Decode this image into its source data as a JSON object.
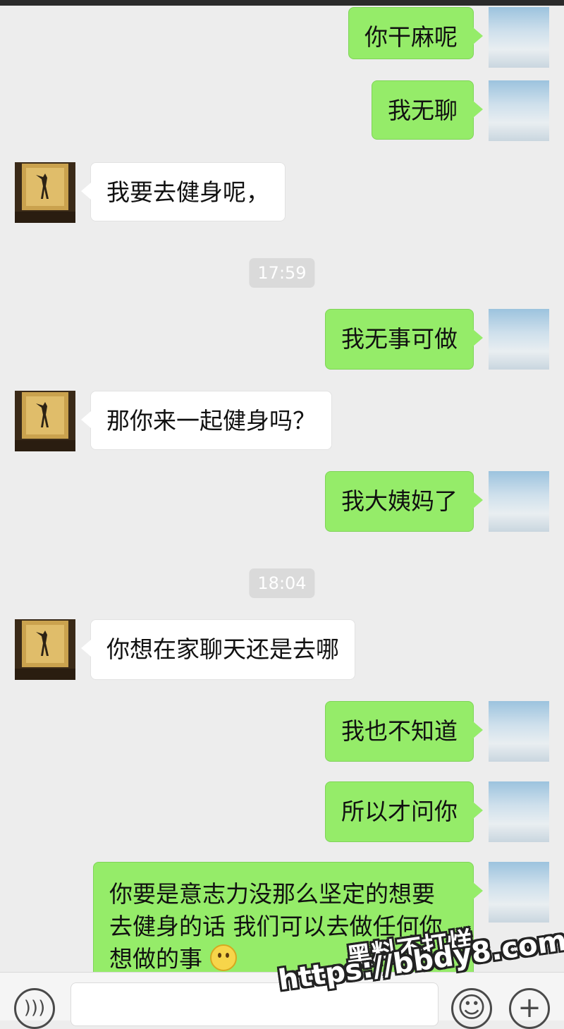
{
  "chat": {
    "messages": [
      {
        "side": "me",
        "text": "你干麻呢"
      },
      {
        "side": "me",
        "text": "我无聊"
      },
      {
        "side": "other",
        "text": "我要去健身呢，"
      },
      {
        "side": "time",
        "text": "17:59"
      },
      {
        "side": "me",
        "text": "我无事可做"
      },
      {
        "side": "other",
        "text": "那你来一起健身吗？"
      },
      {
        "side": "me",
        "text": "我大姨妈了"
      },
      {
        "side": "time",
        "text": "18:04"
      },
      {
        "side": "other",
        "text": "你想在家聊天还是去哪"
      },
      {
        "side": "me",
        "text": "我也不知道"
      },
      {
        "side": "me",
        "text": "所以才问你"
      },
      {
        "side": "me",
        "text_line1": "你要是意志力没那么坚定的想要",
        "text_line2": "去健身的话 我们可以去做任何你",
        "text_line3": "想做的事",
        "emoji": "smile-emoji"
      }
    ]
  },
  "input_bar": {
    "voice_icon": "voice-icon",
    "emoji_icon": "emoji-icon",
    "plus_icon": "plus-icon"
  },
  "watermark": {
    "line1": "黑料不打烊",
    "line2": "https://bbdy8.com"
  },
  "colors": {
    "my_bubble": "#95ec69",
    "other_bubble": "#ffffff",
    "background": "#ededed"
  }
}
